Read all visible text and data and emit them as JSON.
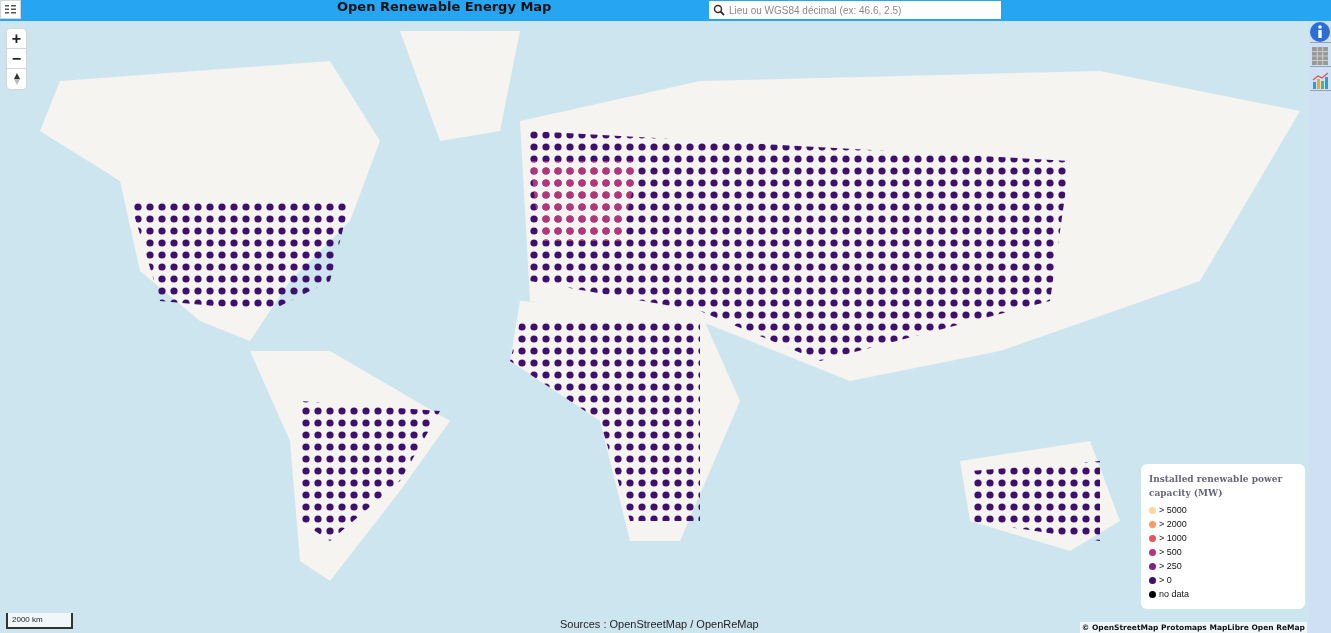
{
  "header": {
    "title": "Open Renewable Energy Map",
    "search": {
      "placeholder": "Lieu ou WGS84 décimal (ex: 46.6, 2.5)"
    }
  },
  "zoom_controls": [
    "+",
    "−"
  ],
  "legend": {
    "title": "Installed renewable power capacity (MW)",
    "items": [
      {
        "label": "> 5000",
        "color": "#fcd89a"
      },
      {
        "label": "> 2000",
        "color": "#f99a63"
      },
      {
        "label": "> 1000",
        "color": "#e8545e"
      },
      {
        "label": "> 500",
        "color": "#b8347a"
      },
      {
        "label": "> 250",
        "color": "#7e2482"
      },
      {
        "label": "> 0",
        "color": "#3e0f6e"
      },
      {
        "label": "no data",
        "color": "#000000"
      }
    ]
  },
  "scale": "2000 km",
  "sources": "Sources : OpenStreetMap / OpenReMap",
  "attribution": "© OpenStreetMap Protomaps MapLibre Open ReMap"
}
